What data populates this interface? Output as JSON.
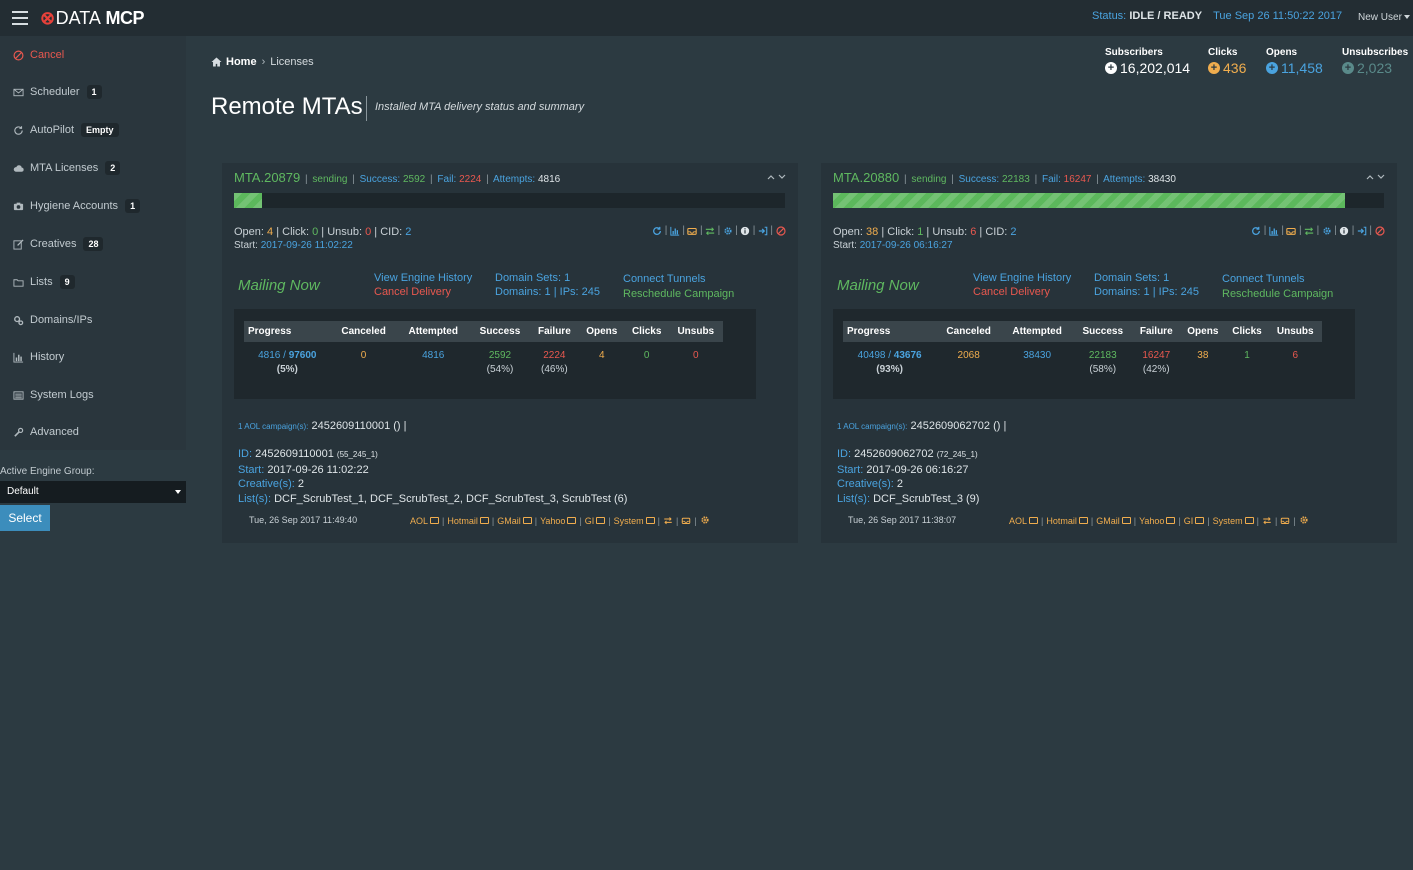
{
  "topbar": {
    "logo_mark": "⊗",
    "logo_data": "DATA",
    "logo_mcp": "MCP",
    "status_label": "Status:",
    "status_value": "IDLE / READY",
    "datetime": "Tue Sep 26 11:50:22 2017",
    "user_menu": "New User"
  },
  "sidebar": {
    "items": [
      {
        "label": "Cancel",
        "icon": "cancel-icon",
        "badge": ""
      },
      {
        "label": "Scheduler",
        "icon": "envelope-icon",
        "badge": "1"
      },
      {
        "label": "AutoPilot",
        "icon": "refresh-icon",
        "badge": "Empty"
      },
      {
        "label": "MTA Licenses",
        "icon": "cloud-icon",
        "badge": "2"
      },
      {
        "label": "Hygiene Accounts",
        "icon": "camera-icon",
        "badge": "1"
      },
      {
        "label": "Creatives",
        "icon": "edit-icon",
        "badge": "28"
      },
      {
        "label": "Lists",
        "icon": "folder-icon",
        "badge": "9"
      },
      {
        "label": "Domains/IPs",
        "icon": "cogs-icon",
        "badge": ""
      },
      {
        "label": "History",
        "icon": "bar-chart-icon",
        "badge": ""
      },
      {
        "label": "System Logs",
        "icon": "list-icon",
        "badge": ""
      },
      {
        "label": "Advanced",
        "icon": "wrench-icon",
        "badge": ""
      }
    ],
    "engine_group_label": "Active Engine Group:",
    "engine_group_value": "Default",
    "select_button": "Select"
  },
  "breadcrumb": {
    "home": "Home",
    "current": "Licenses"
  },
  "page": {
    "title": "Remote MTAs",
    "subtitle": "Installed MTA delivery status and summary"
  },
  "stats": [
    {
      "label": "Subscribers",
      "value": "16,202,014",
      "symbol": "+",
      "color": "#ffffff"
    },
    {
      "label": "Clicks",
      "value": "436",
      "symbol": "+",
      "color": "#f0ad4e"
    },
    {
      "label": "Opens",
      "value": "11,458",
      "symbol": "+",
      "color": "#4aa3df"
    },
    {
      "label": "Unsubscribes",
      "value": "2,023",
      "symbol": "+",
      "color": "#5a8a8a"
    }
  ],
  "labels": {
    "sending": "sending",
    "success": "Success:",
    "fail": "Fail:",
    "attempts": "Attempts:",
    "open": "Open:",
    "click": "Click:",
    "unsub": "Unsub:",
    "cid": "CID:",
    "start": "Start:",
    "mailing_now": "Mailing Now",
    "view_engine_history": "View Engine History",
    "cancel_delivery": "Cancel Delivery",
    "domain_sets": "Domain Sets:",
    "domains": "Domains:",
    "ips": "IPs:",
    "connect_tunnels": "Connect Tunnels",
    "reschedule_campaign": "Reschedule Campaign",
    "aol_campaigns": "1 AOL campaign(s):",
    "id": "ID:",
    "creatives": "Creative(s):",
    "lists": "List(s):",
    "headers": [
      "Progress",
      "Canceled",
      "Attempted",
      "Success",
      "Failure",
      "Opens",
      "Clicks",
      "Unsubs"
    ],
    "foot_links": [
      "AOL",
      "Hotmail",
      "GMail",
      "Yahoo",
      "GI",
      "System"
    ]
  },
  "mtas": [
    {
      "name": "MTA.20879",
      "success": "2592",
      "fail": "2224",
      "attempts": "4816",
      "progress_fraction": 0.05,
      "progress_text": "5%",
      "open": "4",
      "click": "0",
      "unsub": "0",
      "cid": "2",
      "start": "2017-09-26 11:02:22",
      "domain_sets": "1",
      "domains": "1",
      "ips": "245",
      "table": {
        "progress_done": "4816",
        "progress_total": "97600",
        "progress_pct": "(5%)",
        "canceled": "0",
        "attempted": "4816",
        "success": "2592",
        "success_pct": "(54%)",
        "failure": "2224",
        "failure_pct": "(46%)",
        "opens": "4",
        "clicks": "0",
        "unsubs": "0"
      },
      "aol_campaign": "2452609110001",
      "aol_suffix": "() |",
      "id": "2452609110001",
      "id_tag": "(55_245_1)",
      "detail_start": "2017-09-26 11:02:22",
      "creatives": "2",
      "lists": "DCF_ScrubTest_1, DCF_ScrubTest_2, DCF_ScrubTest_3, ScrubTest (6)",
      "footer_date": "Tue, 26 Sep 2017 11:49:40"
    },
    {
      "name": "MTA.20880",
      "success": "22183",
      "fail": "16247",
      "attempts": "38430",
      "progress_fraction": 0.93,
      "progress_text": "93%",
      "open": "38",
      "click": "1",
      "unsub": "6",
      "cid": "2",
      "start": "2017-09-26 06:16:27",
      "domain_sets": "1",
      "domains": "1",
      "ips": "245",
      "table": {
        "progress_done": "40498",
        "progress_total": "43676",
        "progress_pct": "(93%)",
        "canceled": "2068",
        "attempted": "38430",
        "success": "22183",
        "success_pct": "(58%)",
        "failure": "16247",
        "failure_pct": "(42%)",
        "opens": "38",
        "clicks": "1",
        "unsubs": "6"
      },
      "aol_campaign": "2452609062702",
      "aol_suffix": "() |",
      "id": "2452609062702",
      "id_tag": "(72_245_1)",
      "detail_start": "2017-09-26 06:16:27",
      "creatives": "2",
      "lists": "DCF_ScrubTest_3 (9)",
      "footer_date": "Tue, 26 Sep 2017 11:38:07"
    }
  ]
}
